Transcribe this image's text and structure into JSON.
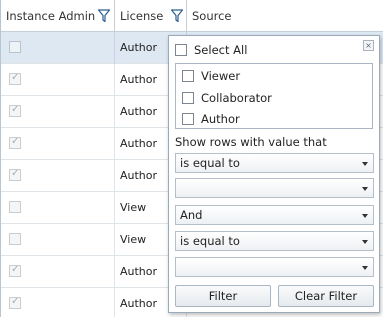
{
  "grid": {
    "columns": [
      {
        "label": "Instance Admin",
        "filter_icon": "filter-icon"
      },
      {
        "label": "License",
        "filter_icon": "filter-icon"
      },
      {
        "label": "Source"
      }
    ],
    "rows": [
      {
        "admin_checked": false,
        "license": "Author",
        "selected": true
      },
      {
        "admin_checked": true,
        "license": "Author"
      },
      {
        "admin_checked": true,
        "license": "Author"
      },
      {
        "admin_checked": true,
        "license": "Author"
      },
      {
        "admin_checked": true,
        "license": "Author"
      },
      {
        "admin_checked": false,
        "license": "View"
      },
      {
        "admin_checked": false,
        "license": "View"
      },
      {
        "admin_checked": true,
        "license": "Author"
      },
      {
        "admin_checked": true,
        "license": "Author"
      }
    ]
  },
  "filter_popup": {
    "select_all_label": "Select All",
    "options": [
      "Viewer",
      "Collaborator",
      "Author"
    ],
    "condition_label": "Show rows with value that",
    "operator1": "is equal to",
    "value1": "",
    "logic": "And",
    "operator2": "is equal to",
    "value2": "",
    "filter_button": "Filter",
    "clear_button": "Clear Filter",
    "close_glyph": "×"
  },
  "colors": {
    "selected_row": "#dde8f3",
    "border": "#9aaab9",
    "filter_icon_stroke": "#2b5f8f"
  }
}
